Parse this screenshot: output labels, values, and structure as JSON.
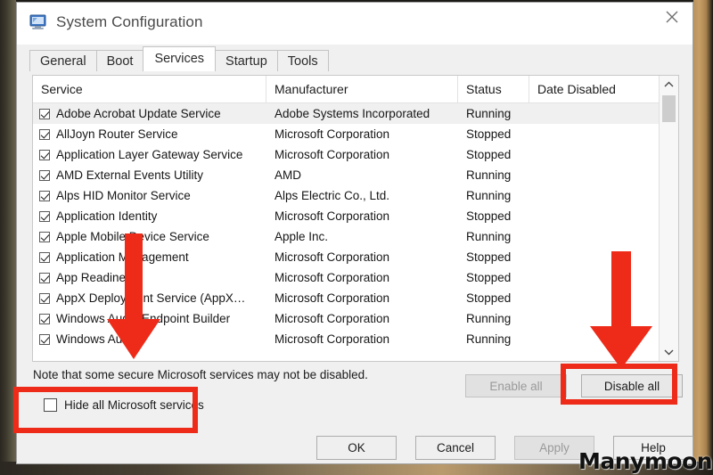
{
  "window": {
    "title": "System Configuration",
    "icon": "computer-monitor-icon",
    "close_label": "✕"
  },
  "tabs": [
    {
      "label": "General",
      "active": false
    },
    {
      "label": "Boot",
      "active": false
    },
    {
      "label": "Services",
      "active": true
    },
    {
      "label": "Startup",
      "active": false
    },
    {
      "label": "Tools",
      "active": false
    }
  ],
  "table": {
    "columns": [
      "Service",
      "Manufacturer",
      "Status",
      "Date Disabled"
    ],
    "rows": [
      {
        "checked": true,
        "service": "Adobe Acrobat Update Service",
        "manufacturer": "Adobe Systems Incorporated",
        "status": "Running",
        "date_disabled": "",
        "selected": true
      },
      {
        "checked": true,
        "service": "AllJoyn Router Service",
        "manufacturer": "Microsoft Corporation",
        "status": "Stopped",
        "date_disabled": "",
        "selected": false
      },
      {
        "checked": true,
        "service": "Application Layer Gateway Service",
        "manufacturer": "Microsoft Corporation",
        "status": "Stopped",
        "date_disabled": "",
        "selected": false
      },
      {
        "checked": true,
        "service": "AMD External Events Utility",
        "manufacturer": "AMD",
        "status": "Running",
        "date_disabled": "",
        "selected": false
      },
      {
        "checked": true,
        "service": "Alps HID Monitor Service",
        "manufacturer": "Alps Electric Co., Ltd.",
        "status": "Running",
        "date_disabled": "",
        "selected": false
      },
      {
        "checked": true,
        "service": "Application Identity",
        "manufacturer": "Microsoft Corporation",
        "status": "Stopped",
        "date_disabled": "",
        "selected": false
      },
      {
        "checked": true,
        "service": "Apple Mobile Device Service",
        "manufacturer": "Apple Inc.",
        "status": "Running",
        "date_disabled": "",
        "selected": false
      },
      {
        "checked": true,
        "service": "Application Management",
        "manufacturer": "Microsoft Corporation",
        "status": "Stopped",
        "date_disabled": "",
        "selected": false
      },
      {
        "checked": true,
        "service": "App Readiness",
        "manufacturer": "Microsoft Corporation",
        "status": "Stopped",
        "date_disabled": "",
        "selected": false
      },
      {
        "checked": true,
        "service": "AppX Deployment Service (AppX…",
        "manufacturer": "Microsoft Corporation",
        "status": "Stopped",
        "date_disabled": "",
        "selected": false
      },
      {
        "checked": true,
        "service": "Windows Audio Endpoint Builder",
        "manufacturer": "Microsoft Corporation",
        "status": "Running",
        "date_disabled": "",
        "selected": false
      },
      {
        "checked": true,
        "service": "Windows Audio",
        "manufacturer": "Microsoft Corporation",
        "status": "Running",
        "date_disabled": "",
        "selected": false
      }
    ]
  },
  "note": "Note that some secure Microsoft services may not be disabled.",
  "hide_all": {
    "label": "Hide all Microsoft services",
    "checked": false
  },
  "buttons": {
    "enable_all": "Enable all",
    "disable_all": "Disable all",
    "ok": "OK",
    "cancel": "Cancel",
    "apply": "Apply",
    "help": "Help"
  },
  "scrollbar": {
    "up_glyph": "⌃",
    "down_glyph": "⌄"
  },
  "annotations": {
    "highlight_color": "#ee2a18",
    "boxes": [
      "hide-all-microsoft-services",
      "disable-all-button"
    ],
    "arrows": [
      "arrow-to-hide-all-microsoft-services",
      "arrow-to-disable-all-button"
    ]
  },
  "watermark": "Manymoon"
}
